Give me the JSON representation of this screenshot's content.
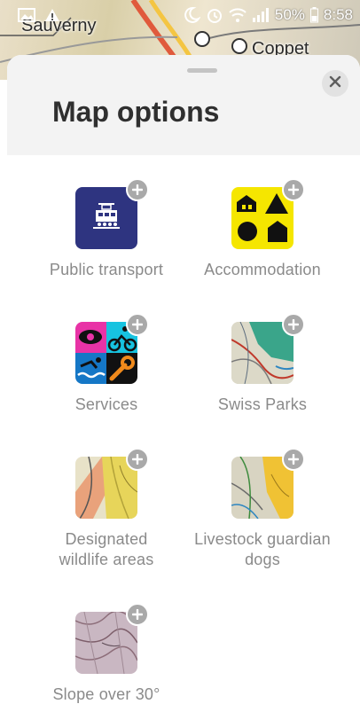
{
  "status_bar": {
    "battery": "50%",
    "time": "8:58",
    "icons": [
      "image-icon",
      "warning-icon",
      "moon-icon",
      "alarm-icon",
      "wifi-icon",
      "signal-icon",
      "battery-icon"
    ]
  },
  "map": {
    "labels": [
      "Sauverny",
      "Coppet"
    ]
  },
  "sheet": {
    "title": "Map options",
    "close_icon": "close-icon"
  },
  "options": [
    {
      "label": "Public transport",
      "icon": "train-icon"
    },
    {
      "label": "Accommodation",
      "icon": "accommodation-icon"
    },
    {
      "label": "Services",
      "icon": "services-icon"
    },
    {
      "label": "Swiss Parks",
      "icon": "map-thumbnail"
    },
    {
      "label_line1": "Designated",
      "label_line2": "wildlife areas",
      "icon": "map-thumbnail"
    },
    {
      "label_line1": "Livestock guardian",
      "label_line2": "dogs",
      "icon": "map-thumbnail"
    },
    {
      "label": "Slope over 30°",
      "icon": "map-thumbnail"
    }
  ],
  "colors": {
    "transport_bg": "#2e3480",
    "accommodation_bg": "#f5e600",
    "plus_badge": "#a9a9a9",
    "label_gray": "#8a8a8a",
    "header_bg": "#f3f3f3"
  }
}
